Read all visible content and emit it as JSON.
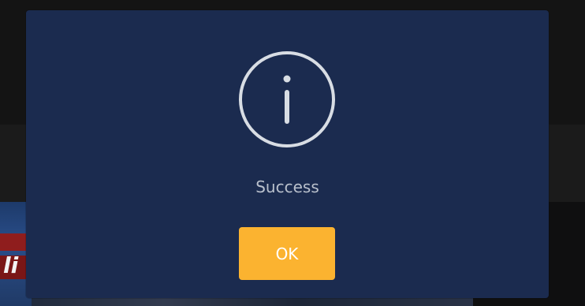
{
  "dialog": {
    "icon": "info-icon",
    "message": "Success",
    "ok_label": "OK"
  },
  "colors": {
    "dialog_background": "#1b2b4f",
    "icon_stroke": "#d8dde4",
    "message_text": "#b9c0cc",
    "button_background": "#fbb330",
    "button_text": "#ffffff",
    "backdrop": "#131313"
  }
}
